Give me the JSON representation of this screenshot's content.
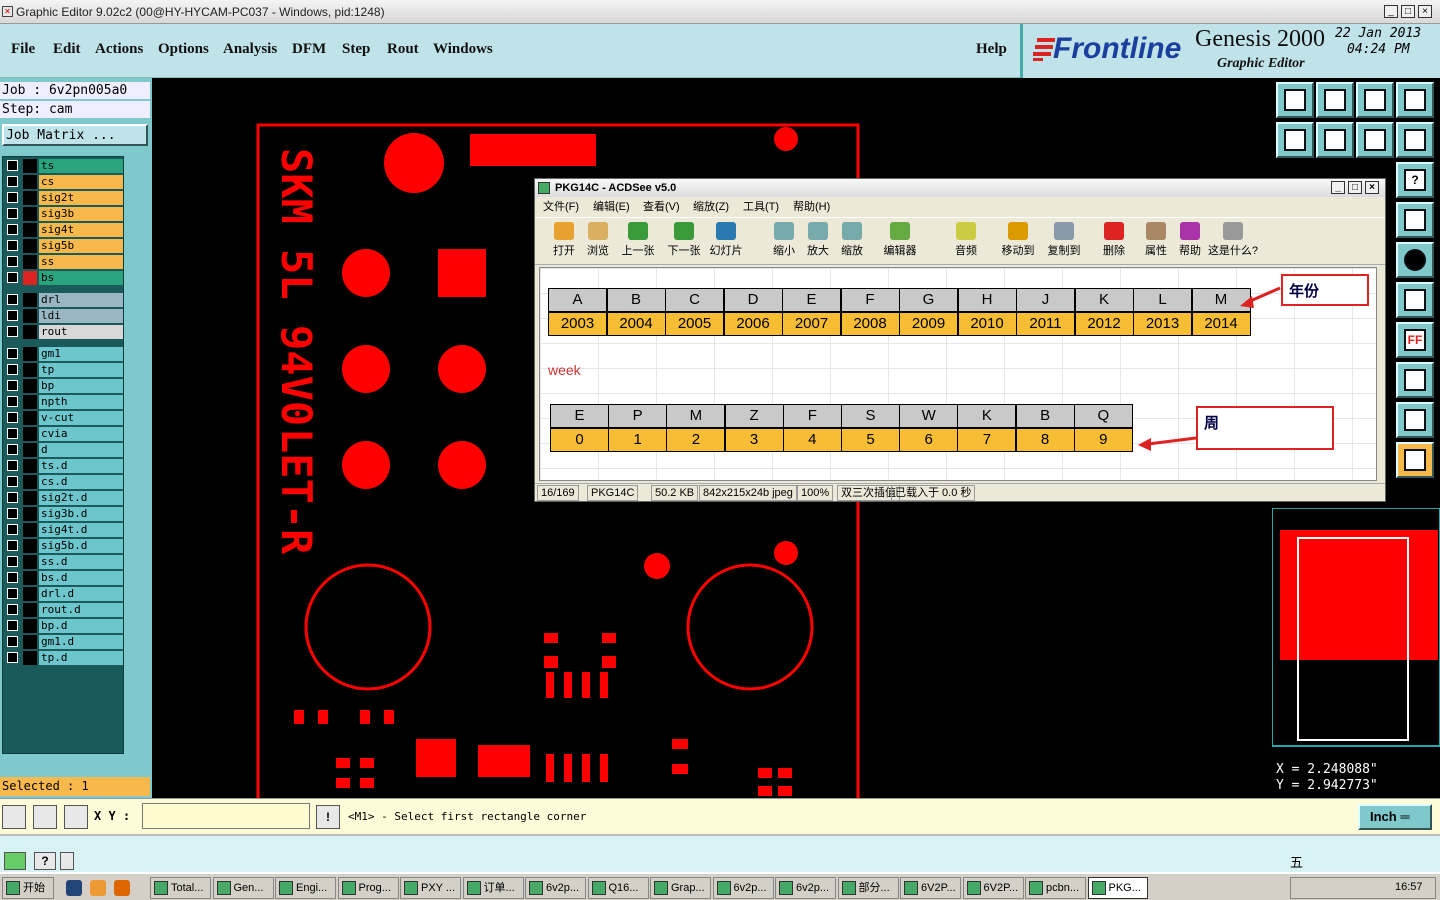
{
  "window_title": "Graphic Editor 9.02c2 (00@HY-HYCAM-PC037 - Windows, pid:1248)",
  "menu": {
    "file": "File",
    "edit": "Edit",
    "actions": "Actions",
    "options": "Options",
    "analysis": "Analysis",
    "dfm": "DFM",
    "step": "Step",
    "rout": "Rout",
    "windows": "Windows",
    "help": "Help"
  },
  "brand": {
    "logo": "Frontline",
    "product": "Genesis 2000",
    "subtitle": "Graphic Editor",
    "date": "22 Jan 2013",
    "time": "04:24 PM"
  },
  "job": {
    "job_line": "Job : 6v2pn005a0",
    "step_line": "Step: cam",
    "matrix_button": "Job Matrix ..."
  },
  "layers": [
    {
      "name": "ts",
      "color": "#2aa37f"
    },
    {
      "name": "cs",
      "color": "#f7b94c"
    },
    {
      "name": "sig2t",
      "color": "#f7b94c"
    },
    {
      "name": "sig3b",
      "color": "#f7b94c"
    },
    {
      "name": "sig4t",
      "color": "#f7b94c"
    },
    {
      "name": "sig5b",
      "color": "#f7b94c"
    },
    {
      "name": "ss",
      "color": "#f7b94c"
    },
    {
      "name": "bs",
      "color": "#2aa37f"
    },
    {
      "name": "drl",
      "color": "#9ab6c4"
    },
    {
      "name": "ldi",
      "color": "#9ab6c4"
    },
    {
      "name": "rout",
      "color": "#d8d8d8"
    },
    {
      "name": "gm1",
      "color": "#6cc6cc"
    },
    {
      "name": "tp",
      "color": "#6cc6cc"
    },
    {
      "name": "bp",
      "color": "#6cc6cc"
    },
    {
      "name": "npth",
      "color": "#6cc6cc"
    },
    {
      "name": "v-cut",
      "color": "#6cc6cc"
    },
    {
      "name": "cvia",
      "color": "#6cc6cc"
    },
    {
      "name": "d",
      "color": "#6cc6cc"
    },
    {
      "name": "ts.d",
      "color": "#6cc6cc"
    },
    {
      "name": "cs.d",
      "color": "#6cc6cc"
    },
    {
      "name": "sig2t.d",
      "color": "#6cc6cc"
    },
    {
      "name": "sig3b.d",
      "color": "#6cc6cc"
    },
    {
      "name": "sig4t.d",
      "color": "#6cc6cc"
    },
    {
      "name": "sig5b.d",
      "color": "#6cc6cc"
    },
    {
      "name": "ss.d",
      "color": "#6cc6cc"
    },
    {
      "name": "bs.d",
      "color": "#6cc6cc"
    },
    {
      "name": "drl.d",
      "color": "#6cc6cc"
    },
    {
      "name": "rout.d",
      "color": "#6cc6cc"
    },
    {
      "name": "bp.d",
      "color": "#6cc6cc"
    },
    {
      "name": "gm1.d",
      "color": "#6cc6cc"
    },
    {
      "name": "tp.d",
      "color": "#6cc6cc"
    }
  ],
  "selected": "Selected : 1",
  "board_text": {
    "line1": "SKM 5L 94V0",
    "line2": "LET-R"
  },
  "coords": {
    "x": "X = 2.248088\"",
    "y": "Y = 2.942773\""
  },
  "status": {
    "xy_label": "X Y :",
    "prompt": "<M1> - Select first rectangle corner",
    "unit": "Inch"
  },
  "acdsee": {
    "title": "PKG14C - ACDSee v5.0",
    "menu": [
      "文件(F)",
      "编辑(E)",
      "查看(V)",
      "缩放(Z)",
      "工具(T)",
      "帮助(H)"
    ],
    "tools": [
      "打开",
      "浏览",
      "上一张",
      "下一张",
      "幻灯片",
      "缩小",
      "放大",
      "缩放",
      "编辑器",
      "音频",
      "移动到",
      "复制到",
      "删除",
      "属性",
      "帮助",
      "这是什么?"
    ],
    "year_headers": [
      "A",
      "B",
      "C",
      "D",
      "E",
      "F",
      "G",
      "H",
      "J",
      "K",
      "L",
      "M"
    ],
    "year_values": [
      "2003",
      "2004",
      "2005",
      "2006",
      "2007",
      "2008",
      "2009",
      "2010",
      "2011",
      "2012",
      "2013",
      "2014"
    ],
    "week_label": "week",
    "week_headers": [
      "E",
      "P",
      "M",
      "Z",
      "F",
      "S",
      "W",
      "K",
      "B",
      "Q"
    ],
    "week_values": [
      "0",
      "1",
      "2",
      "3",
      "4",
      "5",
      "6",
      "7",
      "8",
      "9"
    ],
    "callout_year": "年份",
    "callout_week": "周",
    "status": [
      "16/169",
      "PKG14C",
      "50.2 KB",
      "842x215x24b jpeg",
      "100%",
      "双三次插值",
      "已载入于 0.0 秒"
    ]
  },
  "taskbar": {
    "start": "开始",
    "tasks": [
      "Total...",
      "Gen...",
      "Engi...",
      "Prog...",
      "PXY ...",
      "订单...",
      "6v2p...",
      "Q16...",
      "Grap...",
      "6v2p...",
      "6v2p...",
      "部分...",
      "6V2P...",
      "6V2P...",
      "pcbn...",
      "PKG..."
    ],
    "clock": "16:57",
    "ime": "五"
  }
}
